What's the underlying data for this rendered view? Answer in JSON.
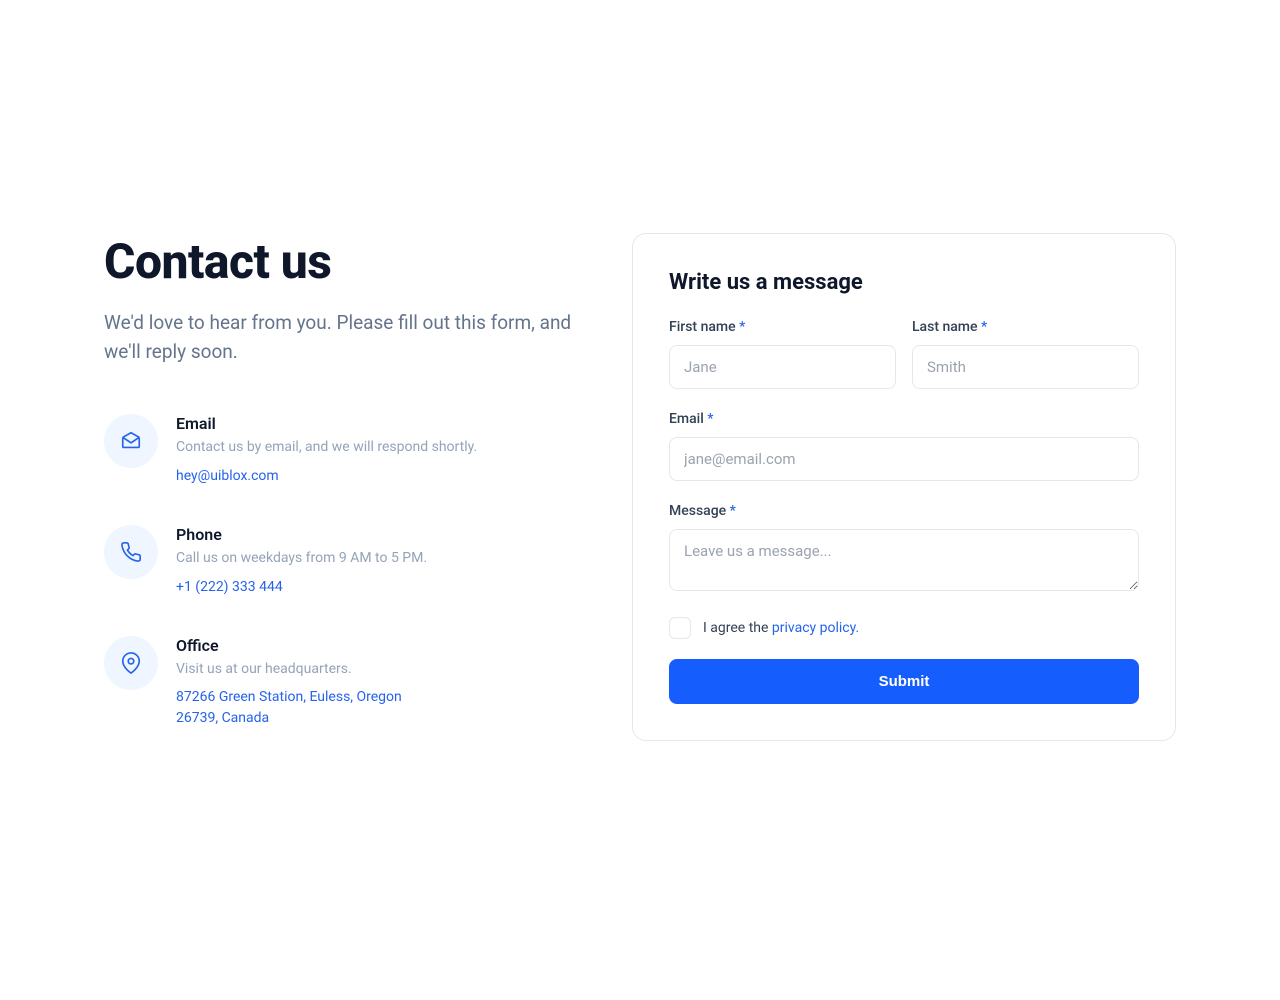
{
  "header": {
    "title": "Contact us",
    "subtitle": "We'd love to hear from you. Please fill out this form, and we'll reply soon."
  },
  "contacts": {
    "email": {
      "title": "Email",
      "desc": "Contact us by email, and we will respond shortly.",
      "link": "hey@uiblox.com"
    },
    "phone": {
      "title": "Phone",
      "desc": "Call us on weekdays from 9 AM to 5 PM.",
      "link": "+1 (222) 333 444"
    },
    "office": {
      "title": "Office",
      "desc": "Visit us at our headquarters.",
      "line1": "87266 Green Station, Euless, Oregon",
      "line2": "26739, Canada"
    }
  },
  "form": {
    "title": "Write us a message",
    "first_name_label": "First name ",
    "first_name_placeholder": "Jane",
    "last_name_label": "Last name ",
    "last_name_placeholder": "Smith",
    "email_label": "Email ",
    "email_placeholder": "jane@email.com",
    "message_label": "Message ",
    "message_placeholder": "Leave us a message...",
    "required": "*",
    "agree_prefix": "I agree the ",
    "policy_link": "privacy policy.",
    "submit": "Submit"
  }
}
